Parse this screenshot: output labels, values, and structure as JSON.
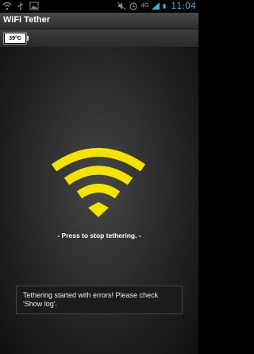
{
  "status_bar": {
    "time": "11:04",
    "network": "4G",
    "icons": [
      "wifi-icon",
      "usb-icon",
      "image-icon",
      "mute-icon",
      "alarm-icon",
      "signal-icon",
      "battery-icon"
    ]
  },
  "app": {
    "title": "WiFi Tether"
  },
  "toolbar": {
    "temperature": "39°C"
  },
  "main": {
    "hint": "- Press to stop tethering. -",
    "wifi_color": "#f4e200"
  },
  "toast": {
    "message": "Tethering started with errors! Please check 'Show log'."
  }
}
